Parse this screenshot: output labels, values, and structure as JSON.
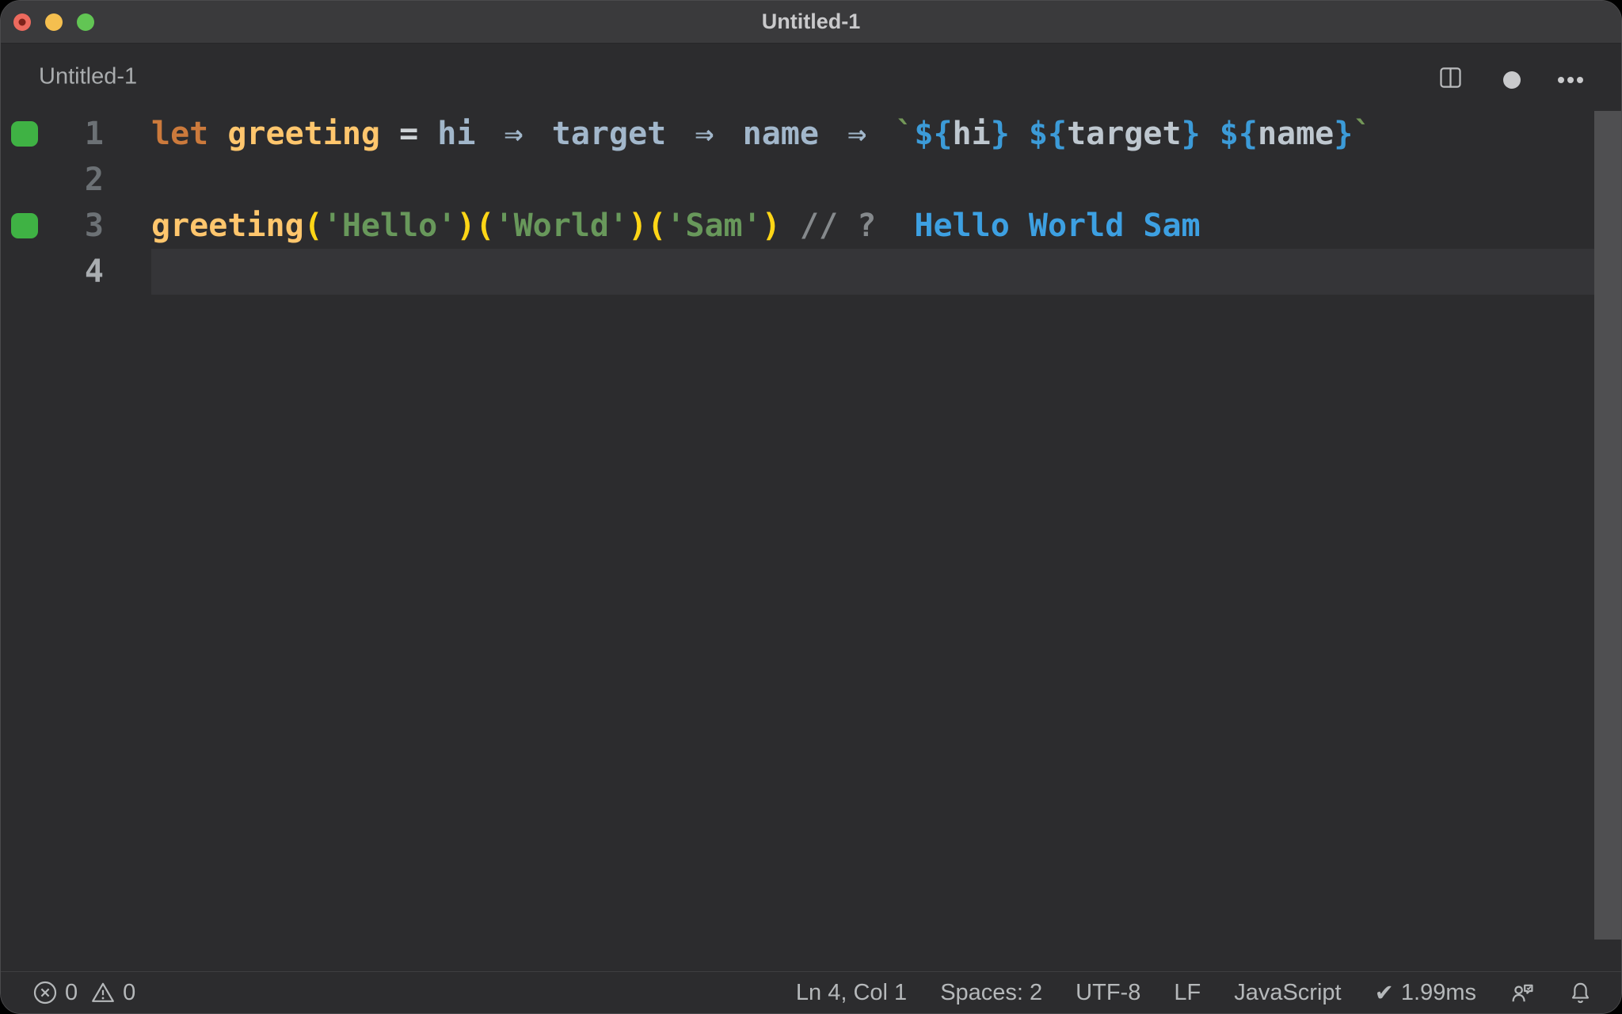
{
  "window": {
    "title": "Untitled-1",
    "traffic_lights": [
      "close",
      "minimize",
      "zoom"
    ],
    "modified": true
  },
  "header": {
    "tab_label": "Untitled-1",
    "actions": [
      "split-editor-icon",
      "unsaved-dot-indicator",
      "more-actions-icon"
    ]
  },
  "editor": {
    "language": "javascript",
    "lines": [
      {
        "number": "1",
        "covered": true,
        "active": false,
        "tokens": [
          {
            "text": "let",
            "type": "keyword"
          },
          {
            "text": " ",
            "type": "plain"
          },
          {
            "text": "greeting",
            "type": "func"
          },
          {
            "text": " = ",
            "type": "op"
          },
          {
            "text": "hi",
            "type": "param"
          },
          {
            "text": " ",
            "type": "plain"
          },
          {
            "text": "⇒",
            "type": "arrow"
          },
          {
            "text": " ",
            "type": "plain"
          },
          {
            "text": "target",
            "type": "param"
          },
          {
            "text": " ",
            "type": "plain"
          },
          {
            "text": "⇒",
            "type": "arrow"
          },
          {
            "text": " ",
            "type": "plain"
          },
          {
            "text": "name",
            "type": "param"
          },
          {
            "text": " ",
            "type": "plain"
          },
          {
            "text": "⇒",
            "type": "arrow"
          },
          {
            "text": " ",
            "type": "plain"
          },
          {
            "text": "`",
            "type": "tstr"
          },
          {
            "text": "${",
            "type": "texpr"
          },
          {
            "text": "hi",
            "type": "tvar"
          },
          {
            "text": "}",
            "type": "texpr"
          },
          {
            "text": " ",
            "type": "plain"
          },
          {
            "text": "${",
            "type": "texpr"
          },
          {
            "text": "target",
            "type": "tvar"
          },
          {
            "text": "}",
            "type": "texpr"
          },
          {
            "text": " ",
            "type": "plain"
          },
          {
            "text": "${",
            "type": "texpr"
          },
          {
            "text": "name",
            "type": "tvar"
          },
          {
            "text": "}",
            "type": "texpr"
          },
          {
            "text": "`",
            "type": "tstr"
          }
        ]
      },
      {
        "number": "2",
        "covered": false,
        "active": false,
        "tokens": []
      },
      {
        "number": "3",
        "covered": true,
        "active": false,
        "tokens": [
          {
            "text": "greeting",
            "type": "func"
          },
          {
            "text": "(",
            "type": "paren"
          },
          {
            "text": "'Hello'",
            "type": "str"
          },
          {
            "text": ")",
            "type": "paren"
          },
          {
            "text": "(",
            "type": "paren"
          },
          {
            "text": "'World'",
            "type": "str"
          },
          {
            "text": ")",
            "type": "paren"
          },
          {
            "text": "(",
            "type": "paren"
          },
          {
            "text": "'Sam'",
            "type": "str"
          },
          {
            "text": ")",
            "type": "paren"
          },
          {
            "text": " ",
            "type": "plain"
          },
          {
            "text": "// ?",
            "type": "comment"
          },
          {
            "text": "  ",
            "type": "plain"
          },
          {
            "text": "Hello World Sam",
            "type": "output"
          }
        ]
      },
      {
        "number": "4",
        "covered": false,
        "active": true,
        "tokens": []
      }
    ]
  },
  "status_bar": {
    "left": [
      {
        "name": "errors",
        "icon": "error-circle-icon",
        "value": "0"
      },
      {
        "name": "warnings",
        "icon": "warning-triangle-icon",
        "value": "0"
      }
    ],
    "right": [
      {
        "name": "cursor-position",
        "label": "Ln 4, Col 1"
      },
      {
        "name": "indentation",
        "label": "Spaces: 2"
      },
      {
        "name": "encoding",
        "label": "UTF-8"
      },
      {
        "name": "eol-sequence",
        "label": "LF"
      },
      {
        "name": "language-mode",
        "label": "JavaScript"
      },
      {
        "name": "quokka-run-time",
        "icon": "check-icon",
        "label": "1.99ms"
      },
      {
        "name": "feedback",
        "icon": "feedback-icon",
        "label": ""
      },
      {
        "name": "notifications",
        "icon": "bell-icon",
        "label": ""
      }
    ]
  },
  "colors": {
    "titlebar_bg": "#3a3a3c",
    "editor_bg": "#2c2c2e",
    "active_line_bg": "#353538",
    "coverage_green": "#3fb244",
    "keyword": "#cc7a3c",
    "function": "#ffc66d",
    "parameter": "#a2b7cb",
    "string": "#68985b",
    "template_expr": "#3c9bd8",
    "bracket": "#ffd616",
    "comment": "#85898c",
    "inline_output": "#3da0e2",
    "traffic_red": "#ed6a5e",
    "traffic_yellow": "#f5bf4f",
    "traffic_green": "#62c554"
  }
}
